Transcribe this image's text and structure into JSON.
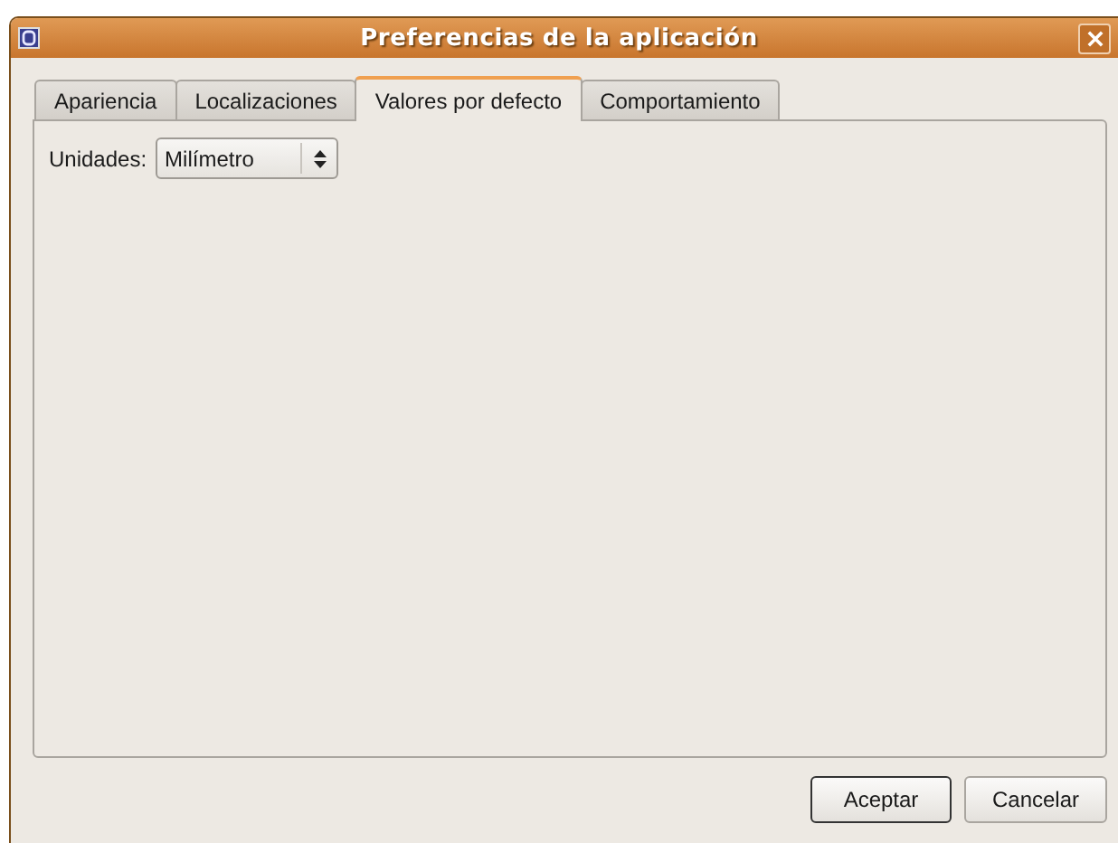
{
  "window": {
    "title": "Preferencias de la aplicación"
  },
  "tabs": [
    {
      "label": "Apariencia",
      "selected": false
    },
    {
      "label": "Localizaciones",
      "selected": false
    },
    {
      "label": "Valores por defecto",
      "selected": true
    },
    {
      "label": "Comportamiento",
      "selected": false
    }
  ],
  "units": {
    "label": "Unidades:",
    "value": "Milímetro"
  },
  "buttons": [
    {
      "label": "Aceptar",
      "default": true
    },
    {
      "label": "Cancelar",
      "default": false
    }
  ]
}
